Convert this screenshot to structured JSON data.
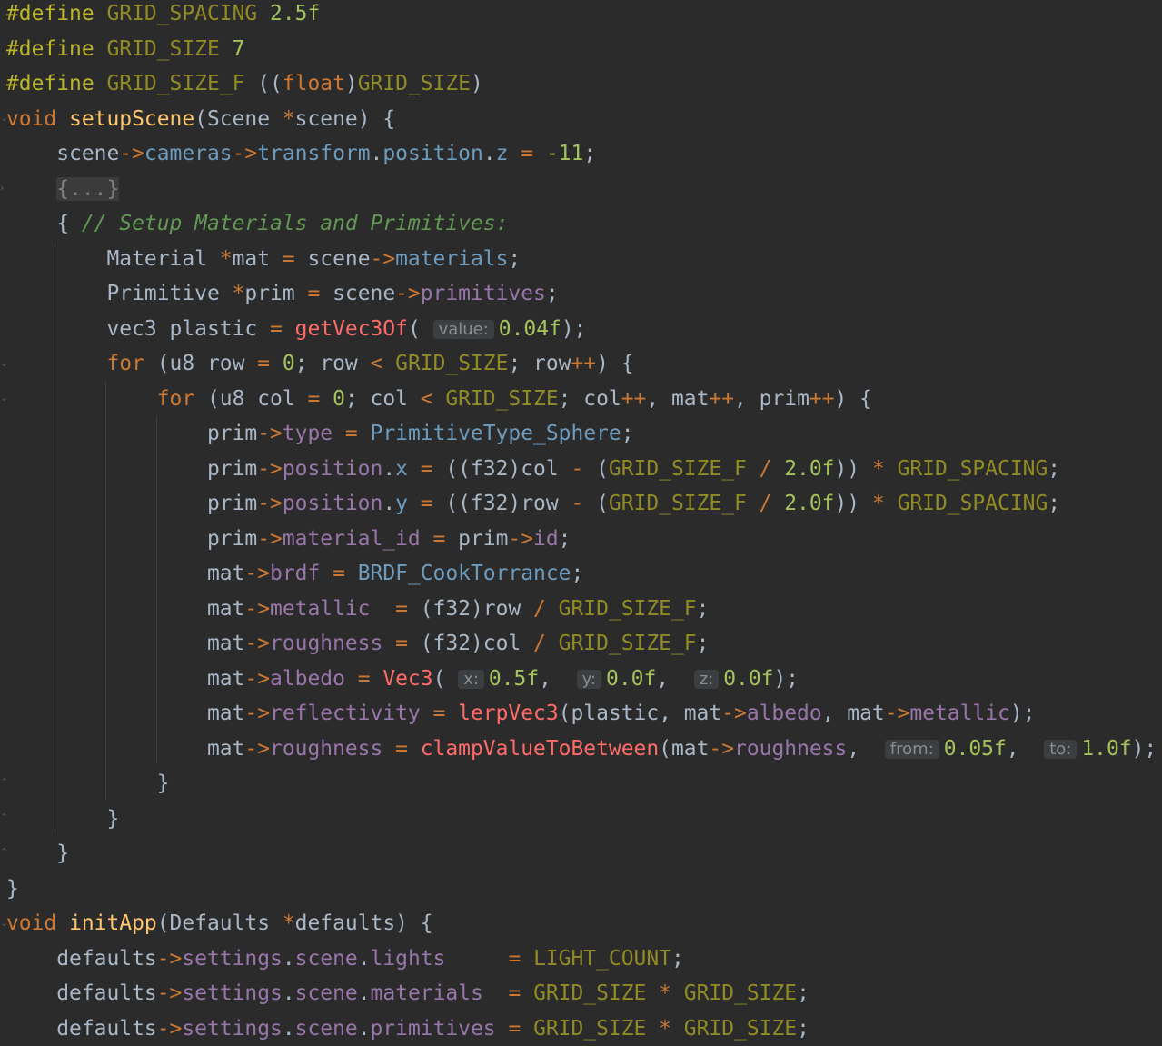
{
  "editor": {
    "lines": [
      {
        "segments": [
          {
            "t": "#define",
            "c": "pp"
          },
          {
            "t": " "
          },
          {
            "t": "GRID_SPACING",
            "c": "mac"
          },
          {
            "t": " "
          },
          {
            "t": "2.5f",
            "c": "numl"
          }
        ]
      },
      {
        "segments": [
          {
            "t": "#define",
            "c": "pp"
          },
          {
            "t": " "
          },
          {
            "t": "GRID_SIZE",
            "c": "mac"
          },
          {
            "t": " "
          },
          {
            "t": "7",
            "c": "numl"
          }
        ]
      },
      {
        "segments": [
          {
            "t": "#define",
            "c": "pp"
          },
          {
            "t": " "
          },
          {
            "t": "GRID_SIZE_F",
            "c": "mac"
          },
          {
            "t": " (("
          },
          {
            "t": "float",
            "c": "kw"
          },
          {
            "t": ")"
          },
          {
            "t": "GRID_SIZE",
            "c": "mac"
          },
          {
            "t": ")"
          }
        ]
      },
      {
        "segments": [
          {
            "t": "void",
            "c": "kw"
          },
          {
            "t": " "
          },
          {
            "t": "setupScene",
            "c": "fn"
          },
          {
            "t": "(Scene "
          },
          {
            "t": "*",
            "c": "op"
          },
          {
            "t": "scene) {"
          }
        ]
      },
      {
        "segments": [
          {
            "t": "    scene"
          },
          {
            "t": "->",
            "c": "op"
          },
          {
            "t": "cameras",
            "c": "mem"
          },
          {
            "t": "->",
            "c": "op"
          },
          {
            "t": "transform",
            "c": "mem"
          },
          {
            "t": "."
          },
          {
            "t": "position",
            "c": "mem"
          },
          {
            "t": "."
          },
          {
            "t": "z",
            "c": "mem"
          },
          {
            "t": " "
          },
          {
            "t": "=",
            "c": "op"
          },
          {
            "t": " "
          },
          {
            "t": "-11",
            "c": "numl"
          },
          {
            "t": ";"
          }
        ]
      },
      {
        "segments": [
          {
            "t": "    "
          },
          {
            "t": "{...}",
            "c": "fold"
          }
        ]
      },
      {
        "segments": [
          {
            "t": "    { "
          },
          {
            "t": "// Setup Materials and Primitives:",
            "c": "cm"
          }
        ]
      },
      {
        "segments": [
          {
            "t": "        Material "
          },
          {
            "t": "*",
            "c": "op"
          },
          {
            "t": "mat "
          },
          {
            "t": "=",
            "c": "op"
          },
          {
            "t": " scene"
          },
          {
            "t": "->",
            "c": "op"
          },
          {
            "t": "materials",
            "c": "mem"
          },
          {
            "t": ";"
          }
        ]
      },
      {
        "segments": [
          {
            "t": "        Primitive "
          },
          {
            "t": "*",
            "c": "op"
          },
          {
            "t": "prim "
          },
          {
            "t": "=",
            "c": "op"
          },
          {
            "t": " scene"
          },
          {
            "t": "->",
            "c": "op"
          },
          {
            "t": "primitives",
            "c": "fld"
          },
          {
            "t": ";"
          }
        ]
      },
      {
        "segments": [
          {
            "t": "        vec3 plastic "
          },
          {
            "t": "=",
            "c": "op"
          },
          {
            "t": " "
          },
          {
            "t": "getVec3Of",
            "c": "call"
          },
          {
            "t": "( "
          },
          {
            "t": "value:",
            "c": "hint"
          },
          {
            "t": "0.04f",
            "c": "numl"
          },
          {
            "t": ");"
          }
        ]
      },
      {
        "segments": [
          {
            "t": "        "
          },
          {
            "t": "for",
            "c": "kw"
          },
          {
            "t": " (u8 row "
          },
          {
            "t": "=",
            "c": "op"
          },
          {
            "t": " "
          },
          {
            "t": "0",
            "c": "numl"
          },
          {
            "t": "; row "
          },
          {
            "t": "<",
            "c": "op"
          },
          {
            "t": " "
          },
          {
            "t": "GRID_SIZE",
            "c": "mac"
          },
          {
            "t": "; row"
          },
          {
            "t": "++",
            "c": "op"
          },
          {
            "t": ") {"
          }
        ]
      },
      {
        "segments": [
          {
            "t": "            "
          },
          {
            "t": "for",
            "c": "kw"
          },
          {
            "t": " (u8 col "
          },
          {
            "t": "=",
            "c": "op"
          },
          {
            "t": " "
          },
          {
            "t": "0",
            "c": "numl"
          },
          {
            "t": "; col "
          },
          {
            "t": "<",
            "c": "op"
          },
          {
            "t": " "
          },
          {
            "t": "GRID_SIZE",
            "c": "mac"
          },
          {
            "t": "; col"
          },
          {
            "t": "++",
            "c": "op"
          },
          {
            "t": ", mat"
          },
          {
            "t": "++",
            "c": "op"
          },
          {
            "t": ", prim"
          },
          {
            "t": "++",
            "c": "op"
          },
          {
            "t": ") {"
          }
        ]
      },
      {
        "segments": [
          {
            "t": "                prim"
          },
          {
            "t": "->",
            "c": "op"
          },
          {
            "t": "type",
            "c": "fld"
          },
          {
            "t": " "
          },
          {
            "t": "=",
            "c": "op"
          },
          {
            "t": " "
          },
          {
            "t": "PrimitiveType_Sphere",
            "c": "mem"
          },
          {
            "t": ";"
          }
        ]
      },
      {
        "segments": [
          {
            "t": "                prim"
          },
          {
            "t": "->",
            "c": "op"
          },
          {
            "t": "position",
            "c": "fld"
          },
          {
            "t": "."
          },
          {
            "t": "x",
            "c": "mem"
          },
          {
            "t": " "
          },
          {
            "t": "=",
            "c": "op"
          },
          {
            "t": " ((f32)col "
          },
          {
            "t": "-",
            "c": "op"
          },
          {
            "t": " ("
          },
          {
            "t": "GRID_SIZE_F",
            "c": "mac"
          },
          {
            "t": " "
          },
          {
            "t": "/",
            "c": "op"
          },
          {
            "t": " "
          },
          {
            "t": "2.0f",
            "c": "numl"
          },
          {
            "t": ")) "
          },
          {
            "t": "*",
            "c": "op"
          },
          {
            "t": " "
          },
          {
            "t": "GRID_SPACING",
            "c": "mac"
          },
          {
            "t": ";"
          }
        ]
      },
      {
        "segments": [
          {
            "t": "                prim"
          },
          {
            "t": "->",
            "c": "op"
          },
          {
            "t": "position",
            "c": "fld"
          },
          {
            "t": "."
          },
          {
            "t": "y",
            "c": "mem"
          },
          {
            "t": " "
          },
          {
            "t": "=",
            "c": "op"
          },
          {
            "t": " ((f32)row "
          },
          {
            "t": "-",
            "c": "op"
          },
          {
            "t": " ("
          },
          {
            "t": "GRID_SIZE_F",
            "c": "mac"
          },
          {
            "t": " "
          },
          {
            "t": "/",
            "c": "op"
          },
          {
            "t": " "
          },
          {
            "t": "2.0f",
            "c": "numl"
          },
          {
            "t": ")) "
          },
          {
            "t": "*",
            "c": "op"
          },
          {
            "t": " "
          },
          {
            "t": "GRID_SPACING",
            "c": "mac"
          },
          {
            "t": ";"
          }
        ]
      },
      {
        "segments": [
          {
            "t": "                prim"
          },
          {
            "t": "->",
            "c": "op"
          },
          {
            "t": "material_id",
            "c": "fld"
          },
          {
            "t": " "
          },
          {
            "t": "=",
            "c": "op"
          },
          {
            "t": " prim"
          },
          {
            "t": "->",
            "c": "op"
          },
          {
            "t": "id",
            "c": "fld"
          },
          {
            "t": ";"
          }
        ]
      },
      {
        "segments": [
          {
            "t": "                mat"
          },
          {
            "t": "->",
            "c": "op"
          },
          {
            "t": "brdf",
            "c": "fld"
          },
          {
            "t": " "
          },
          {
            "t": "=",
            "c": "op"
          },
          {
            "t": " "
          },
          {
            "t": "BRDF_CookTorrance",
            "c": "mem"
          },
          {
            "t": ";"
          }
        ]
      },
      {
        "segments": [
          {
            "t": "                mat"
          },
          {
            "t": "->",
            "c": "op"
          },
          {
            "t": "metallic",
            "c": "fld"
          },
          {
            "t": "  "
          },
          {
            "t": "=",
            "c": "op"
          },
          {
            "t": " (f32)row "
          },
          {
            "t": "/",
            "c": "op"
          },
          {
            "t": " "
          },
          {
            "t": "GRID_SIZE_F",
            "c": "mac"
          },
          {
            "t": ";"
          }
        ]
      },
      {
        "segments": [
          {
            "t": "                mat"
          },
          {
            "t": "->",
            "c": "op"
          },
          {
            "t": "roughness",
            "c": "fld"
          },
          {
            "t": " "
          },
          {
            "t": "=",
            "c": "op"
          },
          {
            "t": " (f32)col "
          },
          {
            "t": "/",
            "c": "op"
          },
          {
            "t": " "
          },
          {
            "t": "GRID_SIZE_F",
            "c": "mac"
          },
          {
            "t": ";"
          }
        ]
      },
      {
        "segments": [
          {
            "t": "                mat"
          },
          {
            "t": "->",
            "c": "op"
          },
          {
            "t": "albedo",
            "c": "fld"
          },
          {
            "t": " "
          },
          {
            "t": "=",
            "c": "op"
          },
          {
            "t": " "
          },
          {
            "t": "Vec3",
            "c": "call"
          },
          {
            "t": "( "
          },
          {
            "t": "x:",
            "c": "hint"
          },
          {
            "t": "0.5f",
            "c": "numl"
          },
          {
            "t": ",  "
          },
          {
            "t": "y:",
            "c": "hint"
          },
          {
            "t": "0.0f",
            "c": "numl"
          },
          {
            "t": ",  "
          },
          {
            "t": "z:",
            "c": "hint"
          },
          {
            "t": "0.0f",
            "c": "numl"
          },
          {
            "t": ");"
          }
        ]
      },
      {
        "segments": [
          {
            "t": "                mat"
          },
          {
            "t": "->",
            "c": "op"
          },
          {
            "t": "reflectivity",
            "c": "fld"
          },
          {
            "t": " "
          },
          {
            "t": "=",
            "c": "op"
          },
          {
            "t": " "
          },
          {
            "t": "lerpVec3",
            "c": "call"
          },
          {
            "t": "(plastic, mat"
          },
          {
            "t": "->",
            "c": "op"
          },
          {
            "t": "albedo",
            "c": "fld"
          },
          {
            "t": ", mat"
          },
          {
            "t": "->",
            "c": "op"
          },
          {
            "t": "metallic",
            "c": "fld"
          },
          {
            "t": ");"
          }
        ]
      },
      {
        "segments": [
          {
            "t": "                mat"
          },
          {
            "t": "->",
            "c": "op"
          },
          {
            "t": "roughness",
            "c": "fld"
          },
          {
            "t": " "
          },
          {
            "t": "=",
            "c": "op"
          },
          {
            "t": " "
          },
          {
            "t": "clampValueToBetween",
            "c": "call"
          },
          {
            "t": "(mat"
          },
          {
            "t": "->",
            "c": "op"
          },
          {
            "t": "roughness",
            "c": "fld"
          },
          {
            "t": ",  "
          },
          {
            "t": "from:",
            "c": "hint"
          },
          {
            "t": "0.05f",
            "c": "numl"
          },
          {
            "t": ",  "
          },
          {
            "t": "to:",
            "c": "hint"
          },
          {
            "t": "1.0f",
            "c": "numl"
          },
          {
            "t": ");"
          }
        ]
      },
      {
        "segments": [
          {
            "t": "            }"
          }
        ]
      },
      {
        "segments": [
          {
            "t": "        }"
          }
        ]
      },
      {
        "segments": [
          {
            "t": "    }"
          }
        ]
      },
      {
        "segments": [
          {
            "t": "}"
          }
        ]
      },
      {
        "segments": [
          {
            "t": "void",
            "c": "kw"
          },
          {
            "t": " "
          },
          {
            "t": "initApp",
            "c": "fn"
          },
          {
            "t": "(Defaults "
          },
          {
            "t": "*",
            "c": "op"
          },
          {
            "t": "defaults) {"
          }
        ]
      },
      {
        "segments": [
          {
            "t": "    defaults"
          },
          {
            "t": "->",
            "c": "op"
          },
          {
            "t": "settings",
            "c": "fld"
          },
          {
            "t": "."
          },
          {
            "t": "scene",
            "c": "fld"
          },
          {
            "t": "."
          },
          {
            "t": "lights",
            "c": "fld"
          },
          {
            "t": "     "
          },
          {
            "t": "=",
            "c": "op"
          },
          {
            "t": " "
          },
          {
            "t": "LIGHT_COUNT",
            "c": "mac"
          },
          {
            "t": ";"
          }
        ]
      },
      {
        "segments": [
          {
            "t": "    defaults"
          },
          {
            "t": "->",
            "c": "op"
          },
          {
            "t": "settings",
            "c": "fld"
          },
          {
            "t": "."
          },
          {
            "t": "scene",
            "c": "fld"
          },
          {
            "t": "."
          },
          {
            "t": "materials",
            "c": "fld"
          },
          {
            "t": "  "
          },
          {
            "t": "=",
            "c": "op"
          },
          {
            "t": " "
          },
          {
            "t": "GRID_SIZE",
            "c": "mac"
          },
          {
            "t": " "
          },
          {
            "t": "*",
            "c": "op"
          },
          {
            "t": " "
          },
          {
            "t": "GRID_SIZE",
            "c": "mac"
          },
          {
            "t": ";"
          }
        ]
      },
      {
        "segments": [
          {
            "t": "    defaults"
          },
          {
            "t": "->",
            "c": "op"
          },
          {
            "t": "settings",
            "c": "fld"
          },
          {
            "t": "."
          },
          {
            "t": "scene",
            "c": "fld"
          },
          {
            "t": "."
          },
          {
            "t": "primitives",
            "c": "fld"
          },
          {
            "t": " "
          },
          {
            "t": "=",
            "c": "op"
          },
          {
            "t": " "
          },
          {
            "t": "GRID_SIZE",
            "c": "mac"
          },
          {
            "t": " "
          },
          {
            "t": "*",
            "c": "op"
          },
          {
            "t": " "
          },
          {
            "t": "GRID_SIZE",
            "c": "mac"
          },
          {
            "t": ";"
          }
        ]
      }
    ]
  }
}
